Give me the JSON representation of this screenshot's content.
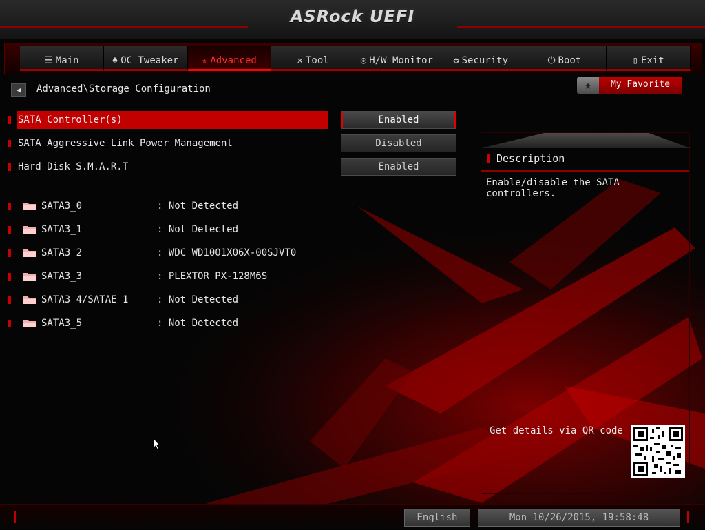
{
  "app": {
    "title": "ASRock UEFI"
  },
  "tabs": [
    {
      "label": "Main",
      "icon": "list-icon",
      "glyph": "☰"
    },
    {
      "label": "OC Tweaker",
      "icon": "rocket-icon",
      "glyph": "♠"
    },
    {
      "label": "Advanced",
      "icon": "star-icon",
      "glyph": "✯",
      "active": true
    },
    {
      "label": "Tool",
      "icon": "wrench-icon",
      "glyph": "✕"
    },
    {
      "label": "H/W Monitor",
      "icon": "monitor-icon",
      "glyph": "◎"
    },
    {
      "label": "Security",
      "icon": "shield-icon",
      "glyph": "✪"
    },
    {
      "label": "Boot",
      "icon": "power-icon",
      "glyph": "⏻"
    },
    {
      "label": "Exit",
      "icon": "exit-icon",
      "glyph": "▯"
    }
  ],
  "breadcrumb": {
    "back_glyph": "◀",
    "path": "Advanced\\Storage Configuration"
  },
  "favorite": {
    "label": "My Favorite",
    "star": "★"
  },
  "settings": [
    {
      "label": "SATA Controller(s)",
      "value": "Enabled",
      "selected": true
    },
    {
      "label": "SATA Aggressive Link Power Management",
      "value": "Disabled"
    },
    {
      "label": "Hard Disk S.M.A.R.T",
      "value": "Enabled"
    }
  ],
  "devices": [
    {
      "name": "SATA3_0",
      "value": ": Not Detected"
    },
    {
      "name": "SATA3_1",
      "value": ": Not Detected"
    },
    {
      "name": "SATA3_2",
      "value": ": WDC WD1001X06X-00SJVT0"
    },
    {
      "name": "SATA3_3",
      "value": ": PLEXTOR PX-128M6S"
    },
    {
      "name": "SATA3_4/SATAE_1",
      "value": ": Not Detected"
    },
    {
      "name": "SATA3_5",
      "value": ": Not Detected"
    }
  ],
  "description": {
    "title": "Description",
    "text": "Enable/disable the SATA controllers.",
    "qr_text": "Get details via QR code"
  },
  "footer": {
    "language": "English",
    "datetime": "Mon 10/26/2015, 19:58:48"
  },
  "colors": {
    "accent": "#c30000",
    "bright_red": "#ff2a2a",
    "bg": "#050505"
  }
}
